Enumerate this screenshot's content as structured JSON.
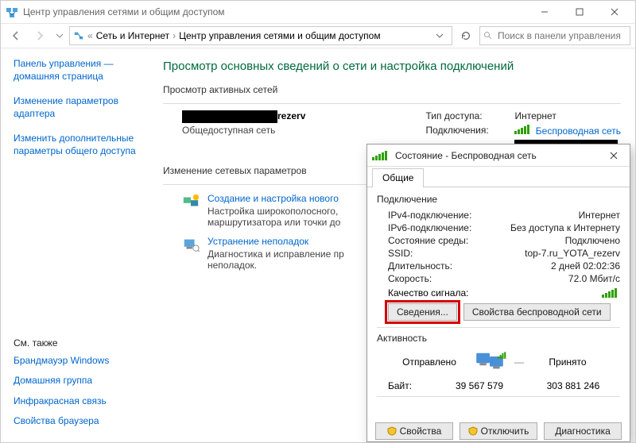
{
  "window": {
    "title": "Центр управления сетями и общим доступом"
  },
  "toolbar": {
    "crumb1": "Сеть и Интернет",
    "crumb2": "Центр управления сетями и общим доступом",
    "search_placeholder": "Поиск в панели управления"
  },
  "sidebar": {
    "links": [
      "Панель управления — домашняя страница",
      "Изменение параметров адаптера",
      "Изменить дополнительные параметры общего доступа"
    ],
    "see_also_label": "См. также",
    "see_also": [
      "Брандмауэр Windows",
      "Домашняя группа",
      "Инфракрасная связь",
      "Свойства браузера"
    ]
  },
  "content": {
    "heading": "Просмотр основных сведений о сети и настройка подключений",
    "active_label": "Просмотр активных сетей",
    "net": {
      "name_suffix": "rezerv",
      "subtype": "Общедоступная сеть",
      "access_k": "Тип доступа:",
      "access_v": "Интернет",
      "conn_k": "Подключения:",
      "conn_v": "Беспроводная сеть"
    },
    "params_label": "Изменение сетевых параметров",
    "param1": {
      "title": "Создание и настройка нового",
      "desc": "Настройка широкополосного, маршрутизатора или точки до"
    },
    "param2": {
      "title": "Устранение неполадок",
      "desc": "Диагностика и исправление пр неполадок."
    }
  },
  "dialog": {
    "title": "Состояние - Беспроводная сеть",
    "tab": "Общие",
    "group_conn": "Подключение",
    "rows": {
      "ipv4_k": "IPv4-подключение:",
      "ipv4_v": "Интернет",
      "ipv6_k": "IPv6-подключение:",
      "ipv6_v": "Без доступа к Интернету",
      "media_k": "Состояние среды:",
      "media_v": "Подключено",
      "ssid_k": "SSID:",
      "ssid_v": "top-7.ru_YOTA_rezerv",
      "dur_k": "Длительность:",
      "dur_v": "2 дней 02:02:36",
      "speed_k": "Скорость:",
      "speed_v": "72.0 Мбит/с",
      "sig_k": "Качество сигнала:"
    },
    "btn_details": "Сведения...",
    "btn_wprops": "Свойства беспроводной сети",
    "group_act": "Активность",
    "act_sent": "Отправлено",
    "act_recv": "Принято",
    "bytes_k": "Байт:",
    "bytes_sent": "39 567 579",
    "bytes_recv": "303 881 246",
    "btn_props": "Свойства",
    "btn_disable": "Отключить",
    "btn_diag": "Диагностика"
  }
}
